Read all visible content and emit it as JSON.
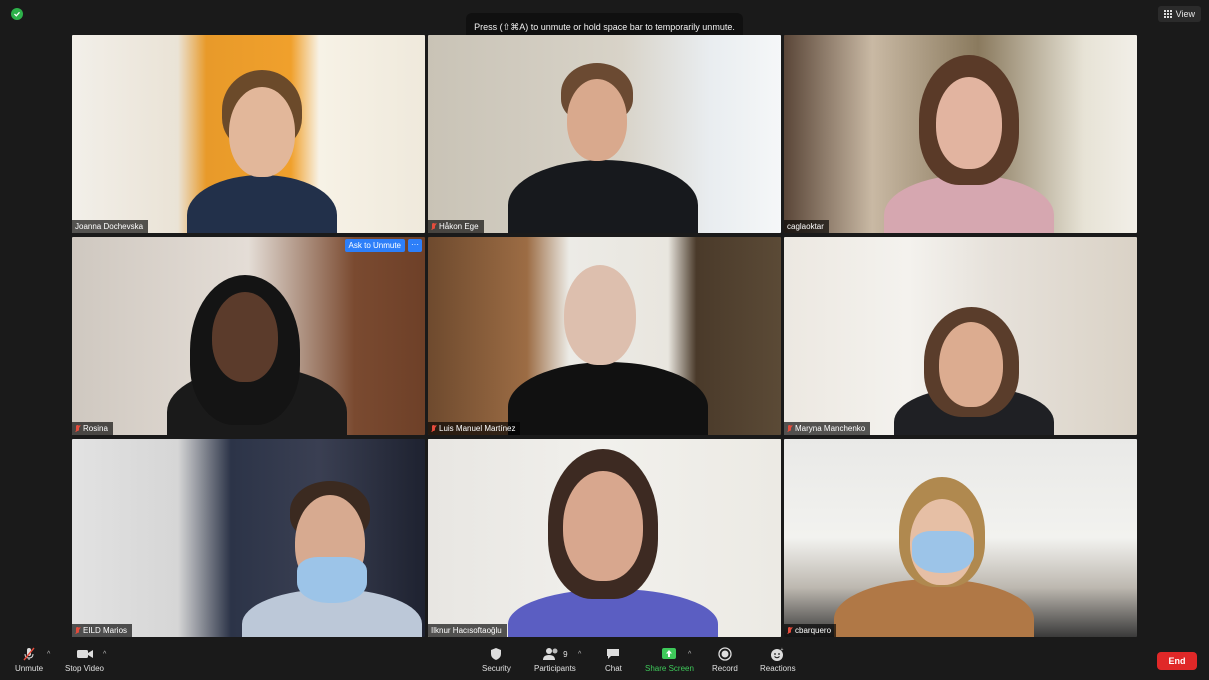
{
  "banner": {
    "text": "Press (⇧⌘A) to unmute or hold space bar to temporarily unmute."
  },
  "view_button": {
    "label": "View"
  },
  "tiles": [
    {
      "name": "Joanna Dochevska",
      "muted": false
    },
    {
      "name": "Håkon Ege",
      "muted": true
    },
    {
      "name": "caglaoktar",
      "muted": false
    },
    {
      "name": "Rosina",
      "muted": true,
      "ask_to_unmute": "Ask to Unmute",
      "more": "···"
    },
    {
      "name": "Luis Manuel Martínez",
      "muted": true
    },
    {
      "name": "Maryna Manchenko",
      "muted": true
    },
    {
      "name": "EILD Marios",
      "muted": true
    },
    {
      "name": "Ilknur Hacısoftaoğlu",
      "muted": false,
      "active": true
    },
    {
      "name": "cbarquero",
      "muted": true
    }
  ],
  "toolbar": {
    "unmute": "Unmute",
    "stop_video": "Stop Video",
    "security": "Security",
    "participants": "Participants",
    "participants_count": "9",
    "chat": "Chat",
    "share_screen": "Share Screen",
    "record": "Record",
    "reactions": "Reactions",
    "end": "End"
  },
  "colors": {
    "accent_blue": "#2d7ff9",
    "active_speaker": "#cde35a",
    "share_green": "#3ec95a",
    "end_red": "#e02828",
    "security_green": "#2db14a"
  }
}
